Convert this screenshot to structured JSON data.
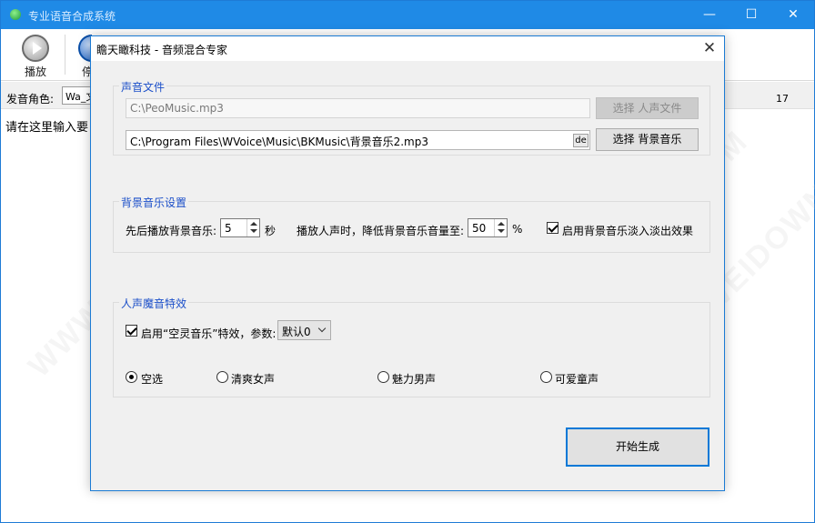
{
  "main_window": {
    "title": "专业语音合成系统",
    "controls": {
      "minimize": "—",
      "maximize": "☐",
      "close": "✕"
    },
    "toolbar": {
      "play_label": "播放",
      "stop_label": "停"
    },
    "voice_role_label": "发音角色:",
    "voice_role_value": "Wa_文",
    "counter": "17",
    "editor_text": "请在这里输入要"
  },
  "dialog": {
    "title": "瞻天瞰科技 - 音频混合专家",
    "close": "✕",
    "sound_files": {
      "title": "声音文件",
      "voice_path": "C:\\PeoMusic.mp3",
      "voice_button": "选择 人声文件",
      "bgm_path": "C:\\Program Files\\WVoice\\Music\\BKMusic\\背景音乐2.mp3",
      "bgm_icon": "de",
      "bgm_button": "选择 背景音乐"
    },
    "bgm_settings": {
      "title": "背景音乐设置",
      "pre_play_label": "先后播放背景音乐:",
      "pre_play_value": "5",
      "pre_play_unit": "秒",
      "lower_label": "播放人声时，降低背景音乐音量至:",
      "lower_value": "50",
      "lower_unit": "%",
      "fade_label": "启用背景音乐淡入淡出效果",
      "fade_checked": true
    },
    "voice_effects": {
      "title": "人声魔音特效",
      "enable_label": "启用“空灵音乐”特效，参数:",
      "enable_checked": true,
      "param_value": "默认0",
      "options": [
        {
          "label": "空选",
          "selected": true
        },
        {
          "label": "清爽女声",
          "selected": false
        },
        {
          "label": "魅力男声",
          "selected": false
        },
        {
          "label": "可爱童声",
          "selected": false
        }
      ]
    },
    "start_button": "开始生成"
  },
  "watermark": "WWW.WEIDOWN.COM"
}
